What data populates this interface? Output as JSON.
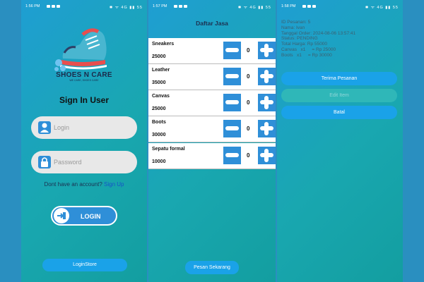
{
  "screens": {
    "login": {
      "status": {
        "time": "1:56 PM",
        "icons": "✱ ᯤ 4G ▮▮ 55"
      },
      "brand": "SHOES N CARE",
      "tagline": "WE CARE, SHOES CARE",
      "heading": "Sign In User",
      "login_placeholder": "Login",
      "password_placeholder": "Password",
      "no_account": "Dont have an account?",
      "signup_link": "Sign Up",
      "login_button": "LOGIN",
      "loginstore_button": "LoginStore"
    },
    "services": {
      "status": {
        "time": "1:57 PM",
        "icons": "✱ ᯤ 4G ▮▮ 55"
      },
      "title": "Daftar Jasa",
      "items": [
        {
          "name": "Sneakers",
          "price": "25000",
          "qty": "0"
        },
        {
          "name": "Leather",
          "price": "35000",
          "qty": "0"
        },
        {
          "name": "Canvas",
          "price": "25000",
          "qty": "0"
        },
        {
          "name": "Boots",
          "price": "30000",
          "qty": "0"
        },
        {
          "name": "Sepatu formal",
          "price": "10000",
          "qty": "0"
        }
      ],
      "order_button": "Pesan Sekarang"
    },
    "order": {
      "status": {
        "time": "1:58 PM",
        "icons": "✱ ᯤ 4G ▮▮ 55"
      },
      "lines": [
        "ID Pesanan: 5",
        "Nama: Ivan",
        "Tanggal Order: 2024-08-06 13:57:41",
        "Status: PENDING",
        "Total Harga: Rp 55000",
        "Canvas   x1     = Rp 25000",
        "Boots   x1     = Rp 30000"
      ],
      "accept_button": "Terima Pesanan",
      "edit_button": "Edit Item",
      "cancel_button": "Batal"
    }
  },
  "colors": {
    "accent": "#2f8fd8",
    "gradient_start": "#1f9ed3",
    "gradient_end": "#139ea0",
    "button_blue": "#1aa2e8"
  }
}
